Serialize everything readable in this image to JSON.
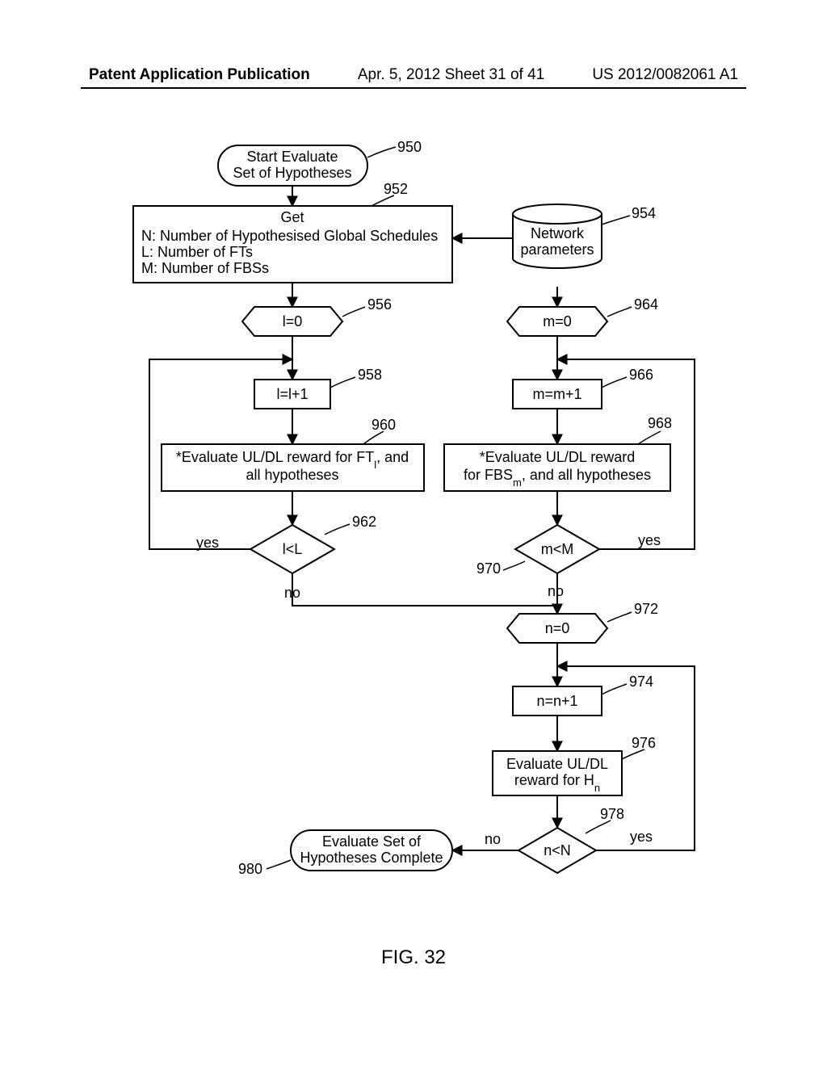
{
  "header": {
    "left": "Patent Application Publication",
    "center": "Apr. 5, 2012  Sheet 31 of 41",
    "right": "US 2012/0082061 A1"
  },
  "figure": {
    "caption": "FIG. 32"
  },
  "nodes": {
    "n950": {
      "line1": "Start Evaluate",
      "line2": "Set of Hypotheses",
      "ref": "950"
    },
    "n952": {
      "title": "Get",
      "l1": "N: Number of Hypothesised Global Schedules",
      "l2": "L: Number of FTs",
      "l3": "M: Number of FBSs",
      "ref": "952"
    },
    "n954": {
      "l1": "Network",
      "l2": "parameters",
      "ref": "954"
    },
    "n956": {
      "text": "l=0",
      "ref": "956"
    },
    "n958": {
      "text": "l=l+1",
      "ref": "958"
    },
    "n960": {
      "l1": "*Evaluate UL/DL reward for FT",
      "sub": "l",
      "l1b": ", and",
      "l2": "all hypotheses",
      "ref": "960"
    },
    "n962": {
      "text": "l<L",
      "ref": "962",
      "yes": "yes",
      "no": "no"
    },
    "n964": {
      "text": "m=0",
      "ref": "964"
    },
    "n966": {
      "text": "m=m+1",
      "ref": "966"
    },
    "n968": {
      "l1": "*Evaluate UL/DL reward",
      "l2a": "for FBS",
      "sub": "m",
      "l2b": ", and all hypotheses",
      "ref": "968"
    },
    "n970": {
      "text": "m<M",
      "ref": "970",
      "yes": "yes",
      "no": "no"
    },
    "n972": {
      "text": "n=0",
      "ref": "972"
    },
    "n974": {
      "text": "n=n+1",
      "ref": "974"
    },
    "n976": {
      "l1": "Evaluate UL/DL",
      "l2a": "reward for H",
      "sub": "n",
      "ref": "976"
    },
    "n978": {
      "text": "n<N",
      "ref": "978",
      "yes": "yes",
      "no": "no"
    },
    "n980": {
      "l1": "Evaluate Set of",
      "l2": "Hypotheses Complete",
      "ref": "980"
    }
  }
}
